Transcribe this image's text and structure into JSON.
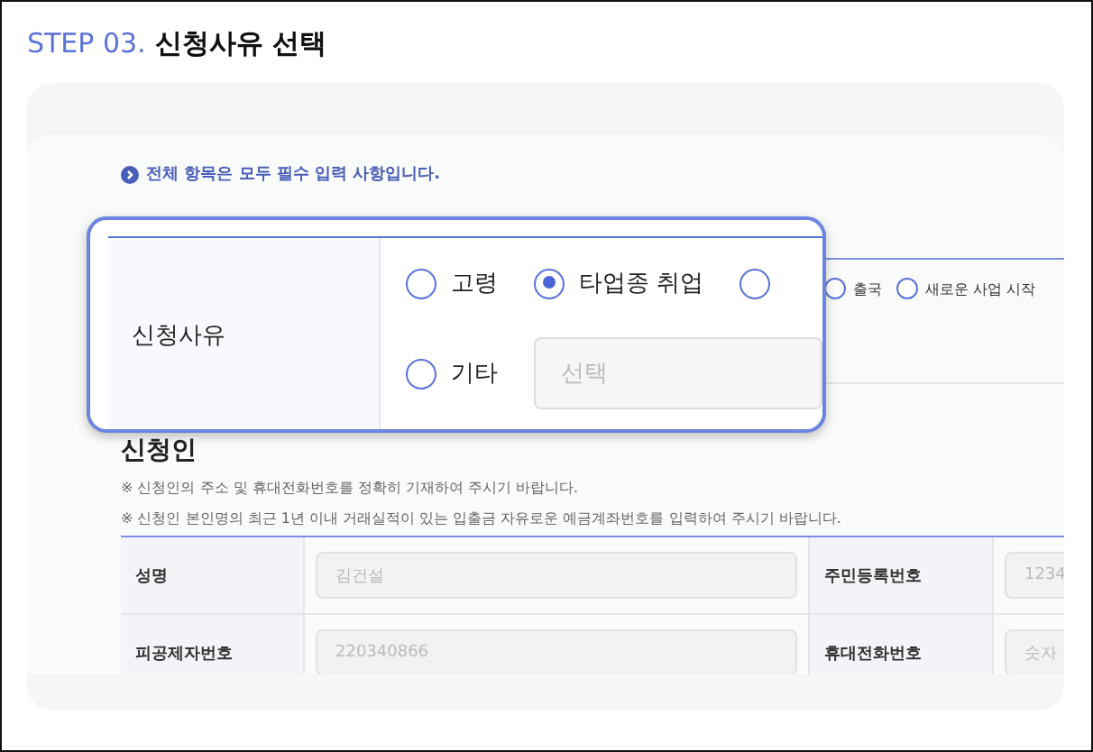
{
  "title": {
    "step": "STEP 03.",
    "text": "신청사유 선택"
  },
  "notice": "전체 항목은 모두 필수 입력 사항입니다.",
  "background_reasons": [
    {
      "label": "출국",
      "selected": false
    },
    {
      "label": "새로운 사업 시작",
      "selected": false
    }
  ],
  "callout": {
    "label": "신청사유",
    "options": [
      {
        "label": "고령",
        "selected": false
      },
      {
        "label": "타업종 취업",
        "selected": true
      },
      {
        "selected": false
      }
    ],
    "other": {
      "label": "기타",
      "selected": false,
      "placeholder": "선택"
    }
  },
  "applicant": {
    "heading": "신청인",
    "notes": [
      "※ 신청인의 주소 및 휴대전화번호를 정확히 기재하여 주시기 바랍니다.",
      "※ 신청인 본인명의 최근 1년 이내 거래실적이 있는 입출금 자유로운 예금계좌번호를 입력하여 주시기 바랍니다."
    ],
    "rows": [
      [
        {
          "label": "성명",
          "value": "김건설"
        },
        {
          "label": "주민등록번호",
          "value": "1234"
        }
      ],
      [
        {
          "label": "피공제자번호",
          "value": "220340866"
        },
        {
          "label": "휴대전화번호",
          "value": "숫자"
        }
      ]
    ]
  }
}
